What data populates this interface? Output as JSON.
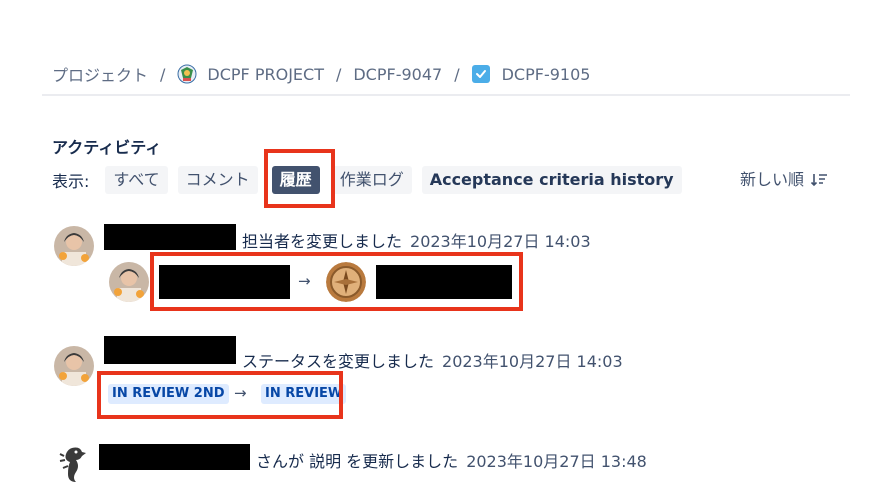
{
  "breadcrumb": {
    "root": "プロジェクト",
    "separator": "/",
    "project": "DCPF PROJECT",
    "parent": "DCPF-9047",
    "current": "DCPF-9105"
  },
  "activity": {
    "title": "アクティビティ",
    "filter_label": "表示:",
    "filters": [
      "すべて",
      "コメント",
      "履歴",
      "作業ログ",
      "Acceptance criteria history"
    ],
    "active_filter": "履歴",
    "sort_label": "新しい順"
  },
  "entries": [
    {
      "action": "担当者を変更しました",
      "timestamp": "2023年10月27日 14:03",
      "arrow": "→"
    },
    {
      "action": "ステータスを変更しました",
      "timestamp": "2023年10月27日 14:03",
      "from_status": "IN REVIEW 2ND",
      "arrow": "→",
      "to_status": "IN REVIEW"
    },
    {
      "action": "さんが 説明 を更新しました",
      "timestamp": "2023年10月27日 13:48"
    }
  ],
  "colors": {
    "highlight": "#e8341b",
    "active_filter_bg": "#42526e",
    "lozenge_bg": "#deebff",
    "lozenge_text": "#0747a6",
    "task_icon": "#4bade8"
  },
  "icons": {
    "project": "project-avatar-icon",
    "task": "task-checkbox-icon",
    "sort": "sort-descending-icon"
  }
}
